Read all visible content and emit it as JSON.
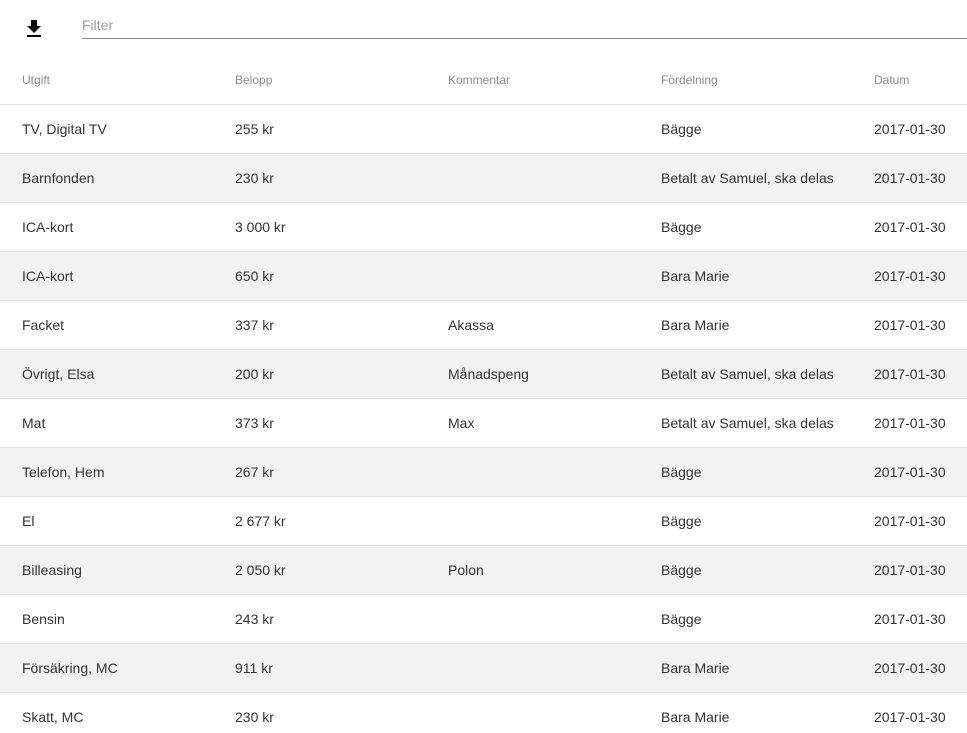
{
  "toolbar": {
    "download_icon": "download-icon",
    "filter_placeholder": "Filter",
    "filter_value": ""
  },
  "table": {
    "columns": [
      "Utgift",
      "Belopp",
      "Kommentar",
      "Fördelning",
      "Datum"
    ],
    "rows": [
      {
        "utgift": "TV, Digital TV",
        "belopp": "255 kr",
        "kommentar": "",
        "fordelning": "Bägge",
        "datum": "2017-01-30"
      },
      {
        "utgift": "Barnfonden",
        "belopp": "230 kr",
        "kommentar": "",
        "fordelning": "Betalt av Samuel, ska delas",
        "datum": "2017-01-30"
      },
      {
        "utgift": "ICA-kort",
        "belopp": "3 000 kr",
        "kommentar": "",
        "fordelning": "Bägge",
        "datum": "2017-01-30"
      },
      {
        "utgift": "ICA-kort",
        "belopp": "650 kr",
        "kommentar": "",
        "fordelning": "Bara Marie",
        "datum": "2017-01-30"
      },
      {
        "utgift": "Facket",
        "belopp": "337 kr",
        "kommentar": "Akassa",
        "fordelning": "Bara Marie",
        "datum": "2017-01-30"
      },
      {
        "utgift": "Övrigt, Elsa",
        "belopp": "200 kr",
        "kommentar": "Månadspeng",
        "fordelning": "Betalt av Samuel, ska delas",
        "datum": "2017-01-30"
      },
      {
        "utgift": "Mat",
        "belopp": "373 kr",
        "kommentar": "Max",
        "fordelning": "Betalt av Samuel, ska delas",
        "datum": "2017-01-30"
      },
      {
        "utgift": "Telefon, Hem",
        "belopp": "267 kr",
        "kommentar": "",
        "fordelning": "Bägge",
        "datum": "2017-01-30"
      },
      {
        "utgift": "El",
        "belopp": "2 677 kr",
        "kommentar": "",
        "fordelning": "Bägge",
        "datum": "2017-01-30"
      },
      {
        "utgift": "Billeasing",
        "belopp": "2 050 kr",
        "kommentar": "Polon",
        "fordelning": "Bägge",
        "datum": "2017-01-30"
      },
      {
        "utgift": "Bensin",
        "belopp": "243 kr",
        "kommentar": "",
        "fordelning": "Bägge",
        "datum": "2017-01-30"
      },
      {
        "utgift": "Försäkring, MC",
        "belopp": "911 kr",
        "kommentar": "",
        "fordelning": "Bara Marie",
        "datum": "2017-01-30"
      },
      {
        "utgift": "Skatt, MC",
        "belopp": "230 kr",
        "kommentar": "",
        "fordelning": "Bara Marie",
        "datum": "2017-01-30"
      }
    ]
  }
}
